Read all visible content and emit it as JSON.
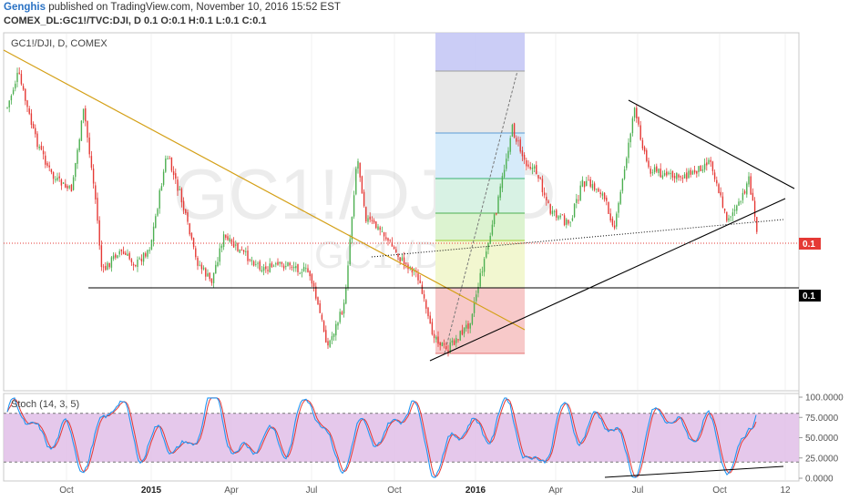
{
  "header": {
    "author": "Genghis",
    "published_text": "published on TradingView.com, November 10, 2016 15:52 EST",
    "ohlc_line": "COMEX_DL:GC1!/TVC:DJI, D  0.1 O:0.1 H:0.1 L:0.1 C:0.1"
  },
  "chart_data": [
    {
      "type": "candlestick",
      "symbol_label": "GC1!/DJI, D, COMEX",
      "watermark_main": "GC1!/DJI, D",
      "watermark_sub": "GC1!/DJI",
      "price_labels": [
        {
          "text": "0.1",
          "color": "#e53935"
        },
        {
          "text": "0.1",
          "color": "#000000"
        }
      ],
      "x_tick_labels": [
        "Oct",
        "2015",
        "Apr",
        "Jul",
        "Oct",
        "2016",
        "Apr",
        "Jul",
        "Oct",
        "12"
      ],
      "x_tick_bold": [
        "2015",
        "2016"
      ],
      "candle_colors": {
        "up": "#4caf50",
        "down": "#e53935"
      }
    },
    {
      "type": "line",
      "title": "Stoch (14, 3, 5)",
      "ylim": [
        0,
        100
      ],
      "y_tick_labels": [
        "100.0000",
        "75.0000",
        "50.0000",
        "25.0000",
        "0.0000"
      ],
      "band": [
        20,
        80
      ],
      "band_color": "#e1bee7",
      "series_colors": [
        "#2196f3",
        "#e53935"
      ]
    }
  ]
}
